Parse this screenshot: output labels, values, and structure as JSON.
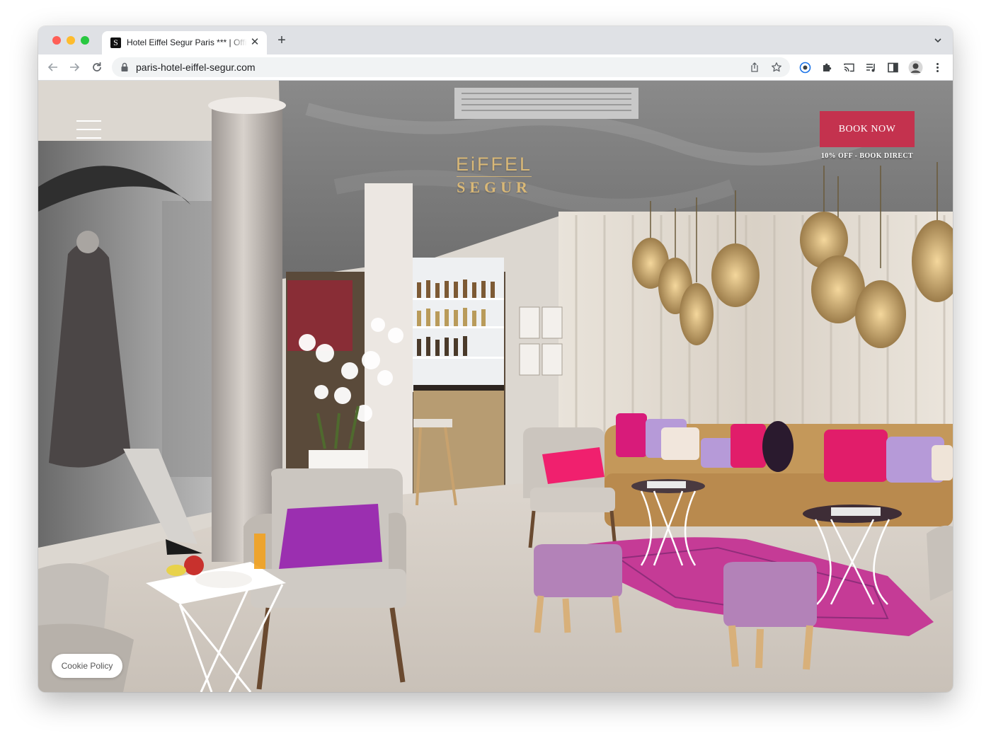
{
  "browser": {
    "tab": {
      "favicon_letter": "S",
      "title": "Hotel Eiffel Segur Paris *** | Official Site",
      "close_glyph": "✕"
    },
    "new_tab_glyph": "+",
    "url": "paris-hotel-eiffel-segur.com",
    "icons": {
      "back": "arrow-left-icon",
      "forward": "arrow-right-icon",
      "reload": "reload-icon",
      "lock": "lock-icon",
      "share": "share-icon",
      "bookmark": "star-icon",
      "extension_1": "shield-extension-icon",
      "extensions": "puzzle-icon",
      "cast": "cast-icon",
      "media": "media-control-icon",
      "side_panel": "side-panel-icon",
      "profile": "avatar",
      "menu": "kebab-menu-icon"
    }
  },
  "site": {
    "logo": {
      "line1": "EiFFEL",
      "line2": "SEGUR"
    },
    "book_now_label": "BOOK NOW",
    "book_subtitle": "10% OFF - BOOK DIRECT",
    "cookie_label": "Cookie Policy",
    "colors": {
      "accent": "#c4324e",
      "logo_gold": "#d9b877"
    },
    "hero_image": "hotel-lounge-photo"
  }
}
